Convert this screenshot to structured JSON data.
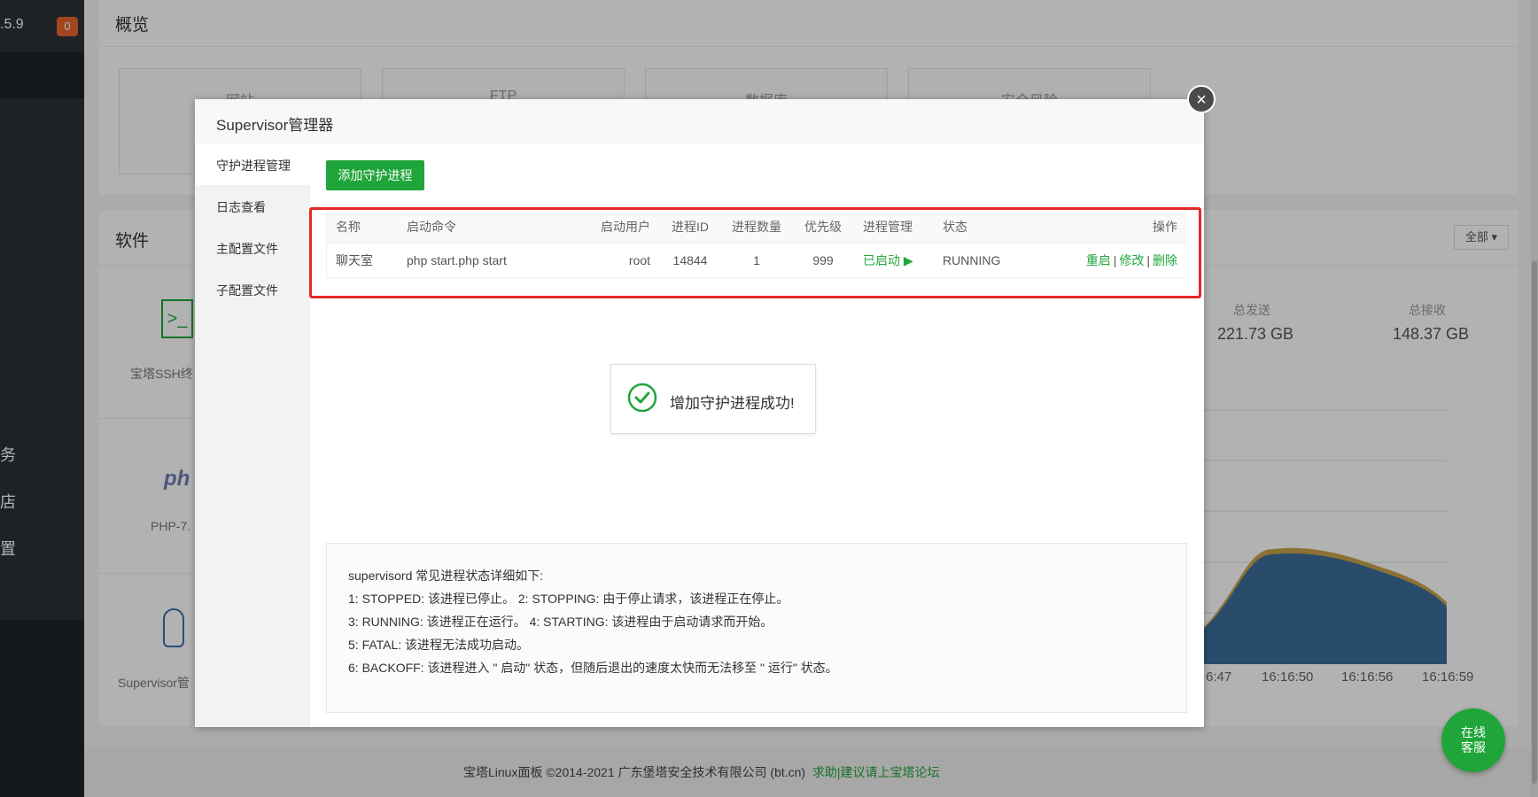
{
  "sidebar": {
    "version": ".5.9",
    "badge": "0",
    "items": [
      "务",
      "店",
      "置"
    ]
  },
  "overview": {
    "title": "概览",
    "cards": [
      "网站",
      "FTP",
      "数据库",
      "安全风险"
    ]
  },
  "software": {
    "title": "软件",
    "filter": "全部 ▾",
    "items": [
      "宝塔SSH终",
      "PHP-7.",
      "Supervisor管"
    ]
  },
  "traffic": {
    "sent_label": "总发送",
    "sent_value": "221.73 GB",
    "recv_label": "总接收",
    "recv_value": "148.37 GB",
    "ticks": [
      "6:47",
      "16:16:50",
      "16:16:56",
      "16:16:59"
    ]
  },
  "modal": {
    "title": "Supervisor管理器",
    "close": "×",
    "nav": [
      "守护进程管理",
      "日志查看",
      "主配置文件",
      "子配置文件"
    ],
    "add_button": "添加守护进程",
    "columns": [
      "名称",
      "启动命令",
      "启动用户",
      "进程ID",
      "进程数量",
      "优先级",
      "进程管理",
      "状态",
      "操作"
    ],
    "rows": [
      {
        "name": "聊天室",
        "command": "php start.php start",
        "user": "root",
        "pid": "14844",
        "count": "1",
        "priority": "999",
        "manage": "已启动 ▶",
        "status": "RUNNING",
        "actions": [
          "重启",
          "修改",
          "删除"
        ]
      }
    ],
    "toast": "增加守护进程成功!",
    "info_lines": [
      "supervisord 常见进程状态详细如下:",
      "1: STOPPED: 该进程已停止。    2: STOPPING: 由于停止请求，该进程正在停止。",
      "3: RUNNING: 该进程正在运行。  4: STARTING: 该进程由于启动请求而开始。",
      "5: FATAL: 该进程无法成功启动。",
      "6: BACKOFF: 该进程进入 \" 启动\" 状态，但随后退出的速度太快而无法移至 \" 运行\" 状态。"
    ]
  },
  "footer": {
    "copyright": "宝塔Linux面板 ©2014-2021 广东堡塔安全技术有限公司 (bt.cn)",
    "link": "求助|建议请上宝塔论坛"
  },
  "chat": {
    "label": "在线客服"
  },
  "colors": {
    "accent": "#20a53a",
    "highlight": "#e52929",
    "badge": "#e8642e"
  }
}
